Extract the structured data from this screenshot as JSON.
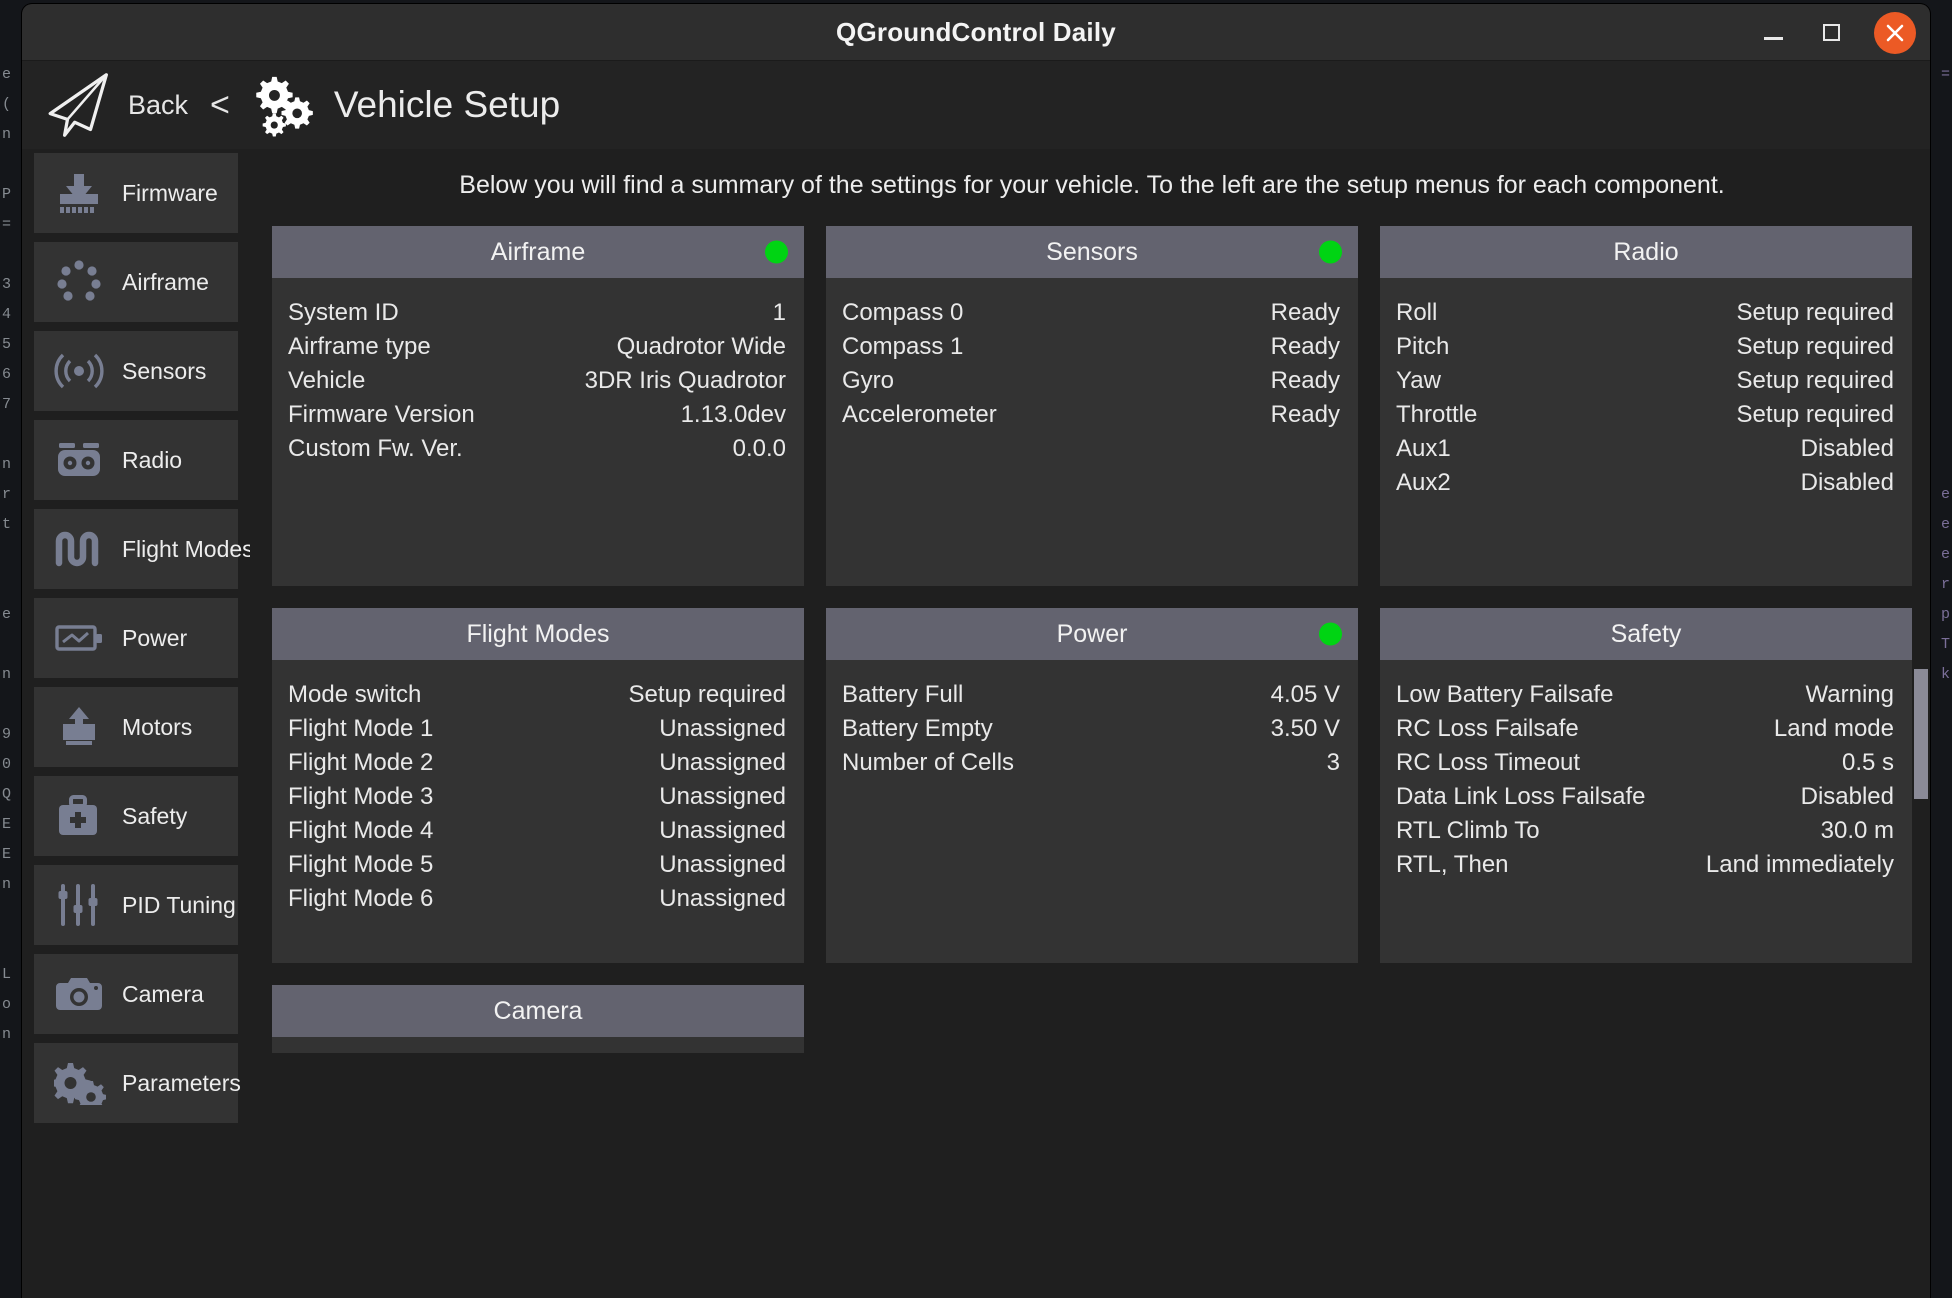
{
  "window": {
    "title": "QGroundControl Daily",
    "minimize_label": "Minimize",
    "maximize_label": "Maximize",
    "close_label": "Close",
    "close_button_color": "#ec5a25"
  },
  "header": {
    "back_label": "Back",
    "back_chevron": "<",
    "page_title": "Vehicle Setup"
  },
  "sidebar": {
    "items": [
      {
        "label": "Firmware",
        "icon": "firmware-download-icon"
      },
      {
        "label": "Airframe",
        "icon": "airframe-dots-icon"
      },
      {
        "label": "Sensors",
        "icon": "sensors-signal-icon"
      },
      {
        "label": "Radio",
        "icon": "radio-controller-icon"
      },
      {
        "label": "Flight Modes",
        "icon": "flight-modes-wave-icon"
      },
      {
        "label": "Power",
        "icon": "power-battery-icon"
      },
      {
        "label": "Motors",
        "icon": "motors-icon"
      },
      {
        "label": "Safety",
        "icon": "safety-kit-icon"
      },
      {
        "label": "PID Tuning",
        "icon": "pid-sliders-icon"
      },
      {
        "label": "Camera",
        "icon": "camera-icon"
      },
      {
        "label": "Parameters",
        "icon": "parameters-gears-icon"
      }
    ]
  },
  "content": {
    "summary_hint": "Below you will find a summary of the settings for your vehicle. To the left are the setup menus for each component.",
    "status_ok_color": "#00d413",
    "cards": [
      {
        "title": "Airframe",
        "has_status_dot": true,
        "rows": [
          {
            "key": "System ID",
            "value": "1"
          },
          {
            "key": "Airframe type",
            "value": "Quadrotor Wide"
          },
          {
            "key": "Vehicle",
            "value": "3DR Iris Quadrotor"
          },
          {
            "key": "Firmware Version",
            "value": "1.13.0dev"
          },
          {
            "key": "Custom Fw. Ver.",
            "value": "0.0.0"
          }
        ]
      },
      {
        "title": "Sensors",
        "has_status_dot": true,
        "rows": [
          {
            "key": "Compass 0",
            "value": "Ready"
          },
          {
            "key": "Compass 1",
            "value": "Ready"
          },
          {
            "key": "Gyro",
            "value": "Ready"
          },
          {
            "key": "Accelerometer",
            "value": "Ready"
          }
        ]
      },
      {
        "title": "Radio",
        "has_status_dot": false,
        "rows": [
          {
            "key": "Roll",
            "value": "Setup required"
          },
          {
            "key": "Pitch",
            "value": "Setup required"
          },
          {
            "key": "Yaw",
            "value": "Setup required"
          },
          {
            "key": "Throttle",
            "value": "Setup required"
          },
          {
            "key": "Aux1",
            "value": "Disabled"
          },
          {
            "key": "Aux2",
            "value": "Disabled"
          }
        ]
      },
      {
        "title": "Flight Modes",
        "has_status_dot": false,
        "rows": [
          {
            "key": "Mode switch",
            "value": "Setup required"
          },
          {
            "key": "Flight Mode 1",
            "value": "Unassigned"
          },
          {
            "key": "Flight Mode 2",
            "value": "Unassigned"
          },
          {
            "key": "Flight Mode 3",
            "value": "Unassigned"
          },
          {
            "key": "Flight Mode 4",
            "value": "Unassigned"
          },
          {
            "key": "Flight Mode 5",
            "value": "Unassigned"
          },
          {
            "key": "Flight Mode 6",
            "value": "Unassigned"
          }
        ]
      },
      {
        "title": "Power",
        "has_status_dot": true,
        "rows": [
          {
            "key": "Battery Full",
            "value": "4.05 V"
          },
          {
            "key": "Battery Empty",
            "value": "3.50 V"
          },
          {
            "key": "Number of Cells",
            "value": "3"
          }
        ]
      },
      {
        "title": "Safety",
        "has_status_dot": false,
        "rows": [
          {
            "key": "Low Battery Failsafe",
            "value": "Warning"
          },
          {
            "key": "RC Loss Failsafe",
            "value": "Land mode"
          },
          {
            "key": "RC Loss Timeout",
            "value": "0.5 s"
          },
          {
            "key": "Data Link Loss Failsafe",
            "value": "Disabled"
          },
          {
            "key": "RTL Climb To",
            "value": "30.0 m"
          },
          {
            "key": "RTL, Then",
            "value": "Land immediately"
          }
        ]
      },
      {
        "title": "Camera",
        "has_status_dot": false,
        "rows": []
      }
    ]
  },
  "backdrop": {
    "left_text": "e\n(\nn\n\nP\n=\n\n3\n4\n5\n6\n7\n\nn\nr\nt\n\n\ne\n\nn\n\n9\n0\nQ\nE\nE\nn\n\n\nL\no\nn",
    "right_text": "=\n\n\n\n\n\n\n\n\n\n\n\n\n\ne\ne\ne\nr\np\nT\nk"
  }
}
